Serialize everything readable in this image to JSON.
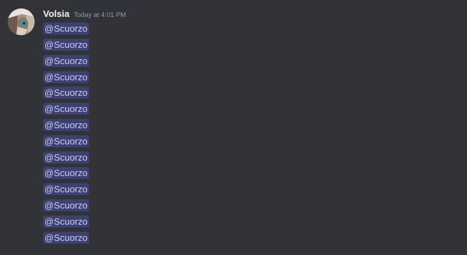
{
  "message": {
    "username": "Volsia",
    "timestamp": "Today at 4:01 PM",
    "avatar": "avatar-image",
    "mentions": [
      "@Scuorzo",
      "@Scuorzo",
      "@Scuorzo",
      "@Scuorzo",
      "@Scuorzo",
      "@Scuorzo",
      "@Scuorzo",
      "@Scuorzo",
      "@Scuorzo",
      "@Scuorzo",
      "@Scuorzo",
      "@Scuorzo",
      "@Scuorzo",
      "@Scuorzo"
    ]
  },
  "colors": {
    "background": "#313338",
    "username": "#f2f3f5",
    "timestamp": "#949ba4",
    "mention_bg": "rgba(88,101,242,0.3)",
    "mention_text": "#c9cdfb"
  }
}
